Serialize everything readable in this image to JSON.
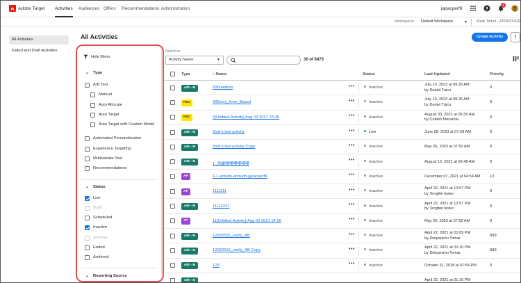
{
  "app": {
    "brand": "Adobe Target",
    "brand_color": "#eb1000"
  },
  "nav": {
    "tabs": [
      "Activities",
      "Audiences",
      "Offers",
      "Recommendations",
      "Administration"
    ],
    "active": "Activities",
    "user": "japacperf8",
    "icons": [
      "apps-grid-icon",
      "help-icon",
      "bell-icon",
      "avatar-icon"
    ],
    "notification_count": "1"
  },
  "workspace": {
    "label": "Workspace:",
    "value": "Default Workspace",
    "user": "Mark Talbot - APPROVER"
  },
  "sidenav": {
    "items": [
      "All Activities",
      "Failed and Draft Activities"
    ]
  },
  "page": {
    "title": "All Activities",
    "create_button": "Create Activity",
    "more_button": "⋮"
  },
  "filters": {
    "hide_label": "Hide filters",
    "type_header": "Type",
    "type_options": [
      {
        "label": "A/B Test",
        "checked": false
      },
      {
        "label": "Manual",
        "checked": false
      },
      {
        "label": "Auto Allocate",
        "checked": false
      },
      {
        "label": "Auto Target",
        "checked": false
      },
      {
        "label": "Auto Target with Custom Model",
        "checked": false
      },
      {
        "label": "Automated Personalization",
        "checked": false
      },
      {
        "label": "Experience Targeting",
        "checked": false
      },
      {
        "label": "Multivariate Test",
        "checked": false
      },
      {
        "label": "Recommendations",
        "checked": false
      }
    ],
    "status_header": "Status",
    "status_options": [
      {
        "label": "Live",
        "checked": true
      },
      {
        "label": "Draft",
        "checked": false,
        "disabled": true
      },
      {
        "label": "Scheduled",
        "checked": false
      },
      {
        "label": "Inactive",
        "checked": true
      },
      {
        "label": "Syncing",
        "checked": false,
        "disabled": true
      },
      {
        "label": "Ended",
        "checked": false
      },
      {
        "label": "Archived",
        "checked": false
      }
    ],
    "reporting_header": "Reporting Source"
  },
  "search": {
    "label": "Search in",
    "field": "Activity Name",
    "count": "30 of 6473"
  },
  "table": {
    "headers": {
      "type": "Type",
      "name": "Name",
      "status": "Status",
      "updated": "Last Updated",
      "priority": "Priority"
    },
    "rows": [
      {
        "type": "A/B - M",
        "name": "000random",
        "status": "Inactive",
        "updated": "July 10, 2023 at 09:26 AM",
        "by": "by Daniel Tuicu",
        "priority": "0"
      },
      {
        "type": "REC",
        "name": "000very_form_Based",
        "status": "Inactive",
        "updated": "July 10, 2023 at 09:26 AM",
        "by": "by Daniel Tuicu",
        "priority": "0"
      },
      {
        "type": "REC",
        "name": "0[Untitled Activity] Aug 03 2021 15:35",
        "status": "Inactive",
        "updated": "August 03, 2021 at 06:35 AM",
        "by": "by Catalin Mocanita",
        "priority": "0"
      },
      {
        "type": "A/B - M",
        "name": "0ndr's test activity",
        "status": "Live",
        "updated": "June 28, 2023 at 07:28 AM",
        "by": "",
        "priority": "0"
      },
      {
        "type": "A/B - M",
        "name": "0ndr's test activity Copy",
        "status": "Inactive",
        "updated": "May 26, 2023 at 07:52 AM",
        "by": "",
        "priority": "0"
      },
      {
        "type": "A/B - M",
        "name": "1_良媛嚶嚶嚶嚶嚶嚶",
        "status": "Inactive",
        "updated": "August 12, 2021 at 06:48 AM",
        "by": "",
        "priority": "0"
      },
      {
        "type": "AP",
        "name": "1-1-activity-anirudh-japacperf8",
        "status": "Inactive",
        "updated": "December 07, 2021 at 04:54 AM",
        "by": "",
        "priority": "10"
      },
      {
        "type": "AP",
        "name": "1111111",
        "status": "Inactive",
        "updated": "April 22, 2021 at 12:57 PM",
        "by": "by Tengfeii tester",
        "priority": "0"
      },
      {
        "type": "A/B - M",
        "name": "11112222",
        "status": "Inactive",
        "updated": "April 22, 2021 at 12:57 PM",
        "by": "by Tengfeii tester",
        "priority": "0"
      },
      {
        "type": "XT",
        "name": "11[Untitled Activity] Aug 03 2021 14:26",
        "status": "Inactive",
        "updated": "May 26, 2023 at 07:52 AM",
        "by": "",
        "priority": "0"
      },
      {
        "type": "A/B - M",
        "name": "12092016_verify_AB",
        "status": "Inactive",
        "updated": "April 22, 2021 at 01:09 PM",
        "by": "by Diwyanshu Tomar",
        "priority": "999"
      },
      {
        "type": "A/B - M",
        "name": "12092016_verify_AB Copy",
        "status": "Inactive",
        "updated": "April 22, 2021 at 01:10 PM",
        "by": "by Diwyanshu Tomar",
        "priority": "999"
      },
      {
        "type": "A/B - M",
        "name": "123",
        "status": "Inactive",
        "updated": "October 31, 2018 at 01:54 PM",
        "by": "",
        "priority": "0"
      },
      {
        "type": "A/B - M",
        "name": "",
        "status": "",
        "updated": "April 22, 2021 at 01:16 PM",
        "by": "",
        "priority": ""
      }
    ]
  }
}
